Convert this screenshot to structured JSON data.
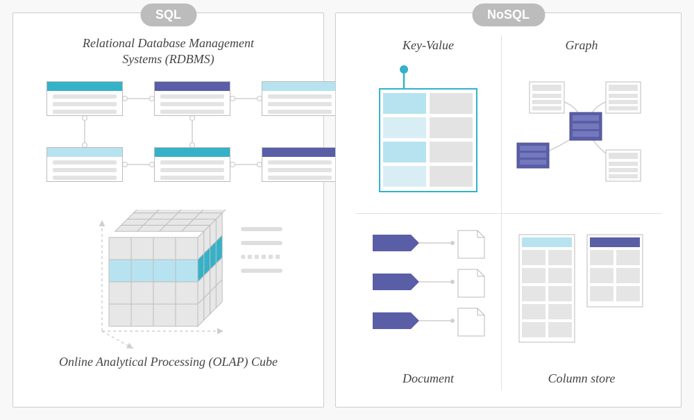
{
  "sql": {
    "badge": "SQL",
    "rdbms_title_line1": "Relational Database Management",
    "rdbms_title_line2": "Systems (RDBMS)",
    "olap_title": "Online Analytical Processing (OLAP) Cube"
  },
  "nosql": {
    "badge": "NoSQL",
    "kv_title": "Key-Value",
    "graph_title": "Graph",
    "doc_title": "Document",
    "col_title": "Column store"
  },
  "colors": {
    "teal": "#35b1c8",
    "indigo": "#5a5ea7",
    "lightblue": "#b6e3ef",
    "grey": "#dcdcdc"
  }
}
